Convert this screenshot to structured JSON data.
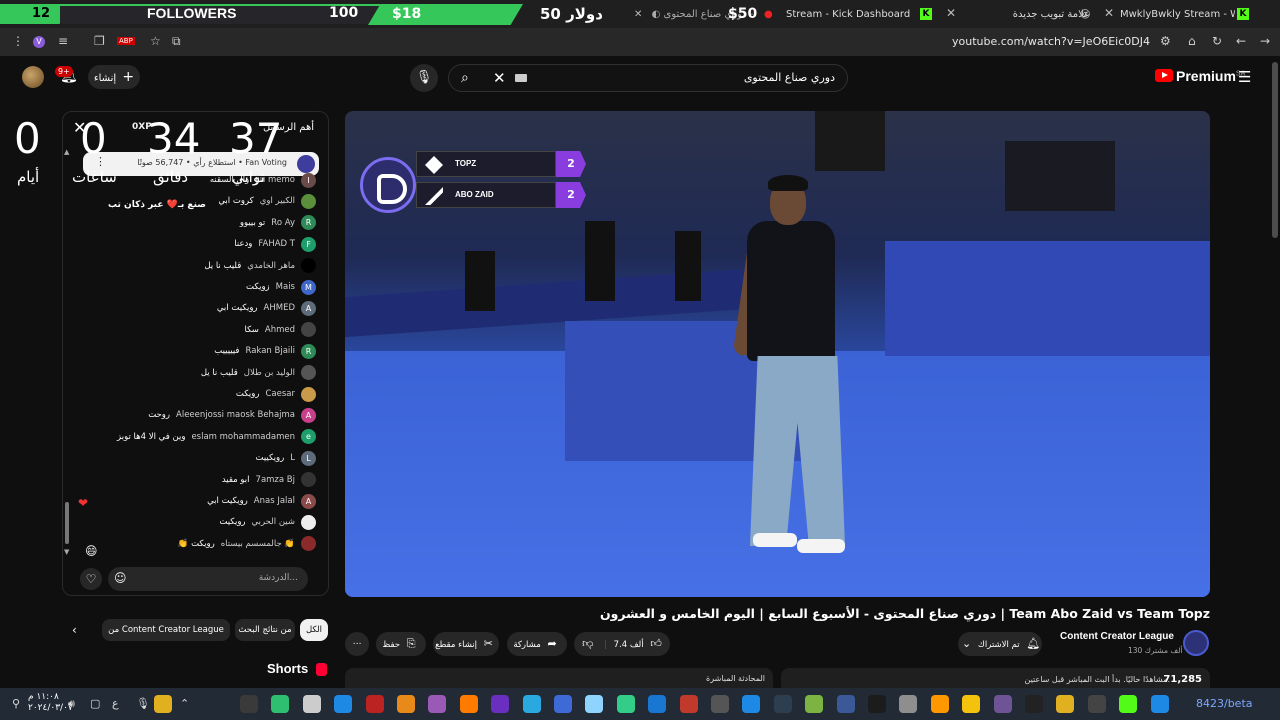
{
  "overlay_bar": {
    "followers_count": "12",
    "followers_label": "FOLLOWERS",
    "followers_goal": "100",
    "money": "$18",
    "money_goal": "دولار 50"
  },
  "tabs": [
    {
      "label": "$50",
      "title": "دوري صناع المحتوى -",
      "active": true
    },
    {
      "label": "Stream - Kick Dashboard"
    },
    {
      "label": "علامة تبويب جديدة"
    },
    {
      "label": "MwklyBwkly Stream - Watch Li"
    }
  ],
  "addressbar": {
    "url": "youtube.com/watch?v=JeO6Eic0DJ4"
  },
  "header": {
    "notification_count": "9+",
    "create_label": "إنشاء",
    "search_value": "دوري صناع المحتوى",
    "logo_text": "Premium",
    "logo_region": "SA"
  },
  "countdown": {
    "days_value": "0",
    "days_label": "أيام",
    "hours_value": "0",
    "hours_label": "ساعات",
    "minutes_value": "34",
    "minutes_label": "دقائق",
    "seconds_value": "37",
    "seconds_label": "ثواني",
    "overlay_message": "صنع بـ❤️ عبر ذكان تب"
  },
  "chat": {
    "title": "أهم الرسائل",
    "xp_badge": "0XP",
    "poll_text": "استطلاع رأي • 56,747 صوتًا • Fan Voting",
    "input_placeholder": "الدردشة...",
    "messages": [
      {
        "name": "jiu memo",
        "text": "وآل السقنه",
        "color": "#6b4a4a",
        "initial": "I"
      },
      {
        "name": "الكبير اوي",
        "text": "كروت ابي",
        "color": "#5a8f3c",
        "initial": ""
      },
      {
        "name": "Ro Ay",
        "text": "تو بييوو",
        "color": "#2e8b57",
        "initial": "R"
      },
      {
        "name": "FAHAD T",
        "text": "ودعنا",
        "color": "#1e9e6a",
        "initial": "F"
      },
      {
        "name": "ماهر الخامدي",
        "text": "قليب نا يل",
        "color": "#000000",
        "initial": ""
      },
      {
        "name": "Mais",
        "text": "زويكت",
        "color": "#3f67c9",
        "initial": "M"
      },
      {
        "name": "AHMED",
        "text": "رويكيت ابي",
        "color": "#5d6b7a",
        "initial": "A"
      },
      {
        "name": "Ahmed",
        "text": "سكا",
        "color": "#444444",
        "initial": ""
      },
      {
        "name": "Rakan Bjaili",
        "text": "فيييييب",
        "color": "#2e8b57",
        "initial": "R"
      },
      {
        "name": "الوليد بن طلال",
        "text": "قليب نا يل",
        "color": "#555555",
        "initial": ""
      },
      {
        "name": "Caesar",
        "text": "رويكت",
        "color": "#c89a4a",
        "initial": ""
      },
      {
        "name": "Aleeenjossi maosk Behajma",
        "text": "روحت",
        "color": "#c8408a",
        "initial": "A"
      },
      {
        "name": "eslam mohammadamen",
        "text": "وين في الا 4ها توبز",
        "color": "#1e9e6a",
        "initial": "e"
      },
      {
        "name": "L",
        "text": "رويكييت",
        "color": "#5d6b7a",
        "initial": "L"
      },
      {
        "name": "7amza Bj",
        "text": "ابو مقيد",
        "color": "#333333",
        "initial": ""
      },
      {
        "name": "Anas Jalal",
        "text": "رويكيت ابي",
        "color": "#8a4a4a",
        "initial": "A"
      },
      {
        "name": "شين الحربي",
        "text": "رويكيت",
        "color": "#eeeeee",
        "initial": ""
      },
      {
        "name": "جالمسسم بيستاه 👏",
        "text": "👏 رويكت",
        "color": "#8a2a2a",
        "initial": ""
      }
    ]
  },
  "video": {
    "scoreboard": [
      {
        "team": "TOPZ",
        "score": "2"
      },
      {
        "team": "ABO ZAID",
        "score": "2"
      }
    ]
  },
  "meta": {
    "title": "دوري صناع المحتوى - الأسبوع السابع | اليوم الخامس و العشرون | Team Abo Zaid vs Team Topz",
    "channel": "Content Creator League",
    "subscribers": "130 ألف مشترك",
    "subscribe_label": "تم الاشتراك",
    "likes": "7.4 ألف",
    "share_label": "مشاركة",
    "clip_label": "إنشاء مقطع",
    "save_label": "حفظ"
  },
  "chips": {
    "all": "الكل",
    "search_results": "من نتائج البحث",
    "from_channel": "من Content Creator League"
  },
  "shorts_label": "Shorts",
  "bottom": {
    "live_chat_label": "المحادثة المباشرة",
    "viewers_count": "71,285",
    "viewers_text": "مشاهدًا حاليًا. بدأ البث المباشر قبل ساعتين."
  },
  "taskbar": {
    "time": "١١:٠٨ م",
    "date": "٢٠٢٤/٠٣/٠٧",
    "lang": "ع",
    "version": "8423/beta"
  }
}
